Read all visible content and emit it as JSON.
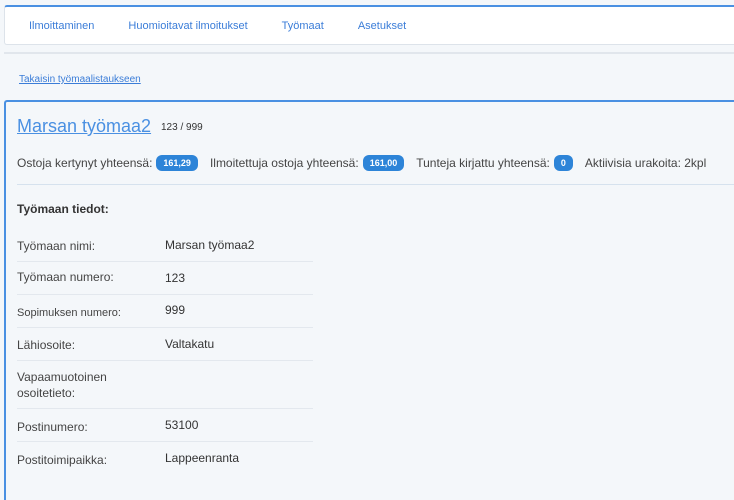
{
  "nav": {
    "items": [
      "Ilmoittaminen",
      "Huomioitavat ilmoitukset",
      "Työmaat",
      "Asetukset"
    ]
  },
  "back_link": "Takaisin työmaalistaukseen",
  "site": {
    "title": "Marsan työmaa2",
    "numbers": "123 / 999"
  },
  "stats": [
    {
      "label": "Ostoja kertynyt yhteensä:",
      "value": "161,29"
    },
    {
      "label": "Ilmoitettuja ostoja yhteensä:",
      "value": "161,00"
    },
    {
      "label": "Tunteja kirjattu yhteensä:",
      "value": "0"
    },
    {
      "label": "Aktiivisia urakoita: 2kpl"
    }
  ],
  "details": {
    "heading": "Työmaan tiedot:",
    "rows": [
      {
        "label": "Työmaan nimi:",
        "value": "Marsan työmaa2"
      },
      {
        "label": "Työmaan numero:",
        "value": "123"
      },
      {
        "label": "Sopimuksen numero:",
        "value": "999"
      },
      {
        "label": "Lähiosoite:",
        "value": "Valtakatu"
      },
      {
        "label": "Vapaamuotoinen osoitetieto:",
        "value": ""
      },
      {
        "label": "Postinumero:",
        "value": "53100"
      },
      {
        "label": "Postitoimipaikka:",
        "value": "Lappeenranta"
      }
    ]
  }
}
